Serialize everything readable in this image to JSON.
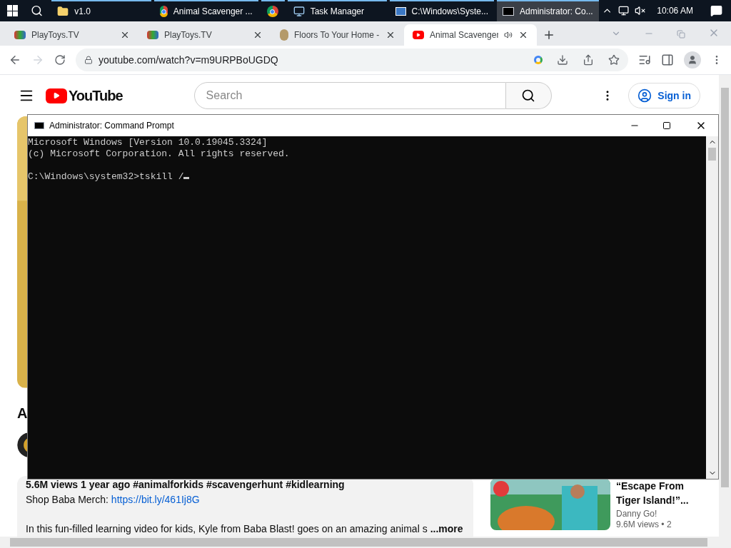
{
  "taskbar": {
    "items": [
      {
        "label": "v1.0",
        "kind": "folder",
        "selected": false
      },
      {
        "label": "Animal Scavenger ...",
        "kind": "chrome",
        "selected": false
      },
      {
        "kind": "chrome-only",
        "selected": false
      },
      {
        "label": "Task Manager",
        "kind": "taskmgr",
        "selected": false
      },
      {
        "label": "C:\\Windows\\Syste...",
        "kind": "explorer",
        "selected": false
      },
      {
        "label": "Administrator: Co...",
        "kind": "cmd",
        "selected": true
      }
    ],
    "clock": "10:06 AM"
  },
  "browser": {
    "tabs": [
      {
        "title": "PlayToys.TV",
        "kind": "toy",
        "selected": false,
        "audio": false
      },
      {
        "title": "PlayToys.TV",
        "kind": "toy",
        "selected": false,
        "audio": false
      },
      {
        "title": "Floors To Your Home -",
        "kind": "person",
        "selected": false,
        "audio": false
      },
      {
        "title": "Animal Scavenger",
        "kind": "youtube",
        "selected": true,
        "audio": true
      }
    ],
    "url": "youtube.com/watch?v=m9URPBoUGDQ"
  },
  "youtube": {
    "logo": "YouTube",
    "search_placeholder": "Search",
    "sign_in": "Sign in",
    "video_title": "A",
    "views_line": "5.6M views  1 year ago  #animalforkids #scavengerhunt #kidlearning",
    "merch_label": "Shop Baba Merch: ",
    "merch_link": "https://bit.ly/461Ij8G",
    "description": "In this fun-filled learning video for kids, Kyle from Baba Blast!  goes on an amazing animal s",
    "more": "...more",
    "recommended": [
      {
        "title": "“Escape From Tiger Island!”...",
        "channel": "Danny Go!",
        "meta": "9.6M views  • 2"
      }
    ]
  },
  "console": {
    "title": "Administrator: Command Prompt",
    "blocks": [
      [
        "Microsoft Windows [Version 10.0.19045.3324]",
        "(c) Microsoft Corporation. All rights reserved."
      ],
      [
        "C:\\Windows\\system32>tskill /"
      ]
    ]
  }
}
